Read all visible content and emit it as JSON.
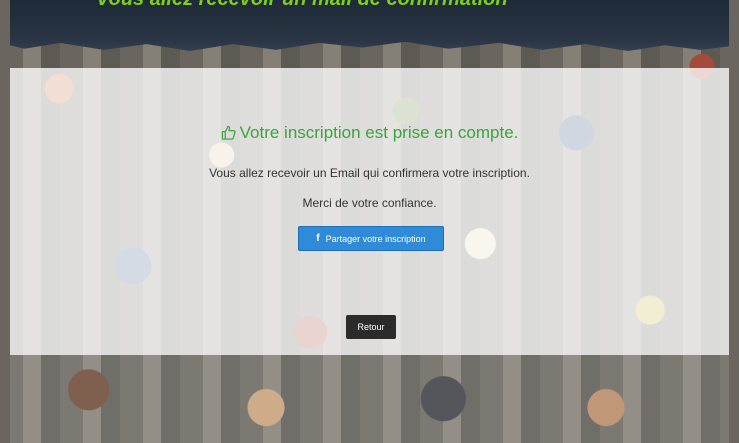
{
  "top_banner": {
    "text": "Vous allez recevoir un mail de confirmation"
  },
  "confirmation": {
    "headline": "Votre inscription est prise en compte.",
    "message": "Vous allez recevoir un Email qui confirmera votre inscription.",
    "thanks": "Merci de votre confiance."
  },
  "share_button": {
    "icon": "facebook-icon",
    "label": "Partager votre inscription"
  },
  "back_button": {
    "label": "Retour"
  },
  "colors": {
    "headline": "#3aa53a",
    "banner_text": "#7fce1c",
    "share_button": "#2f8ad8",
    "back_button": "#2b2b2b"
  }
}
